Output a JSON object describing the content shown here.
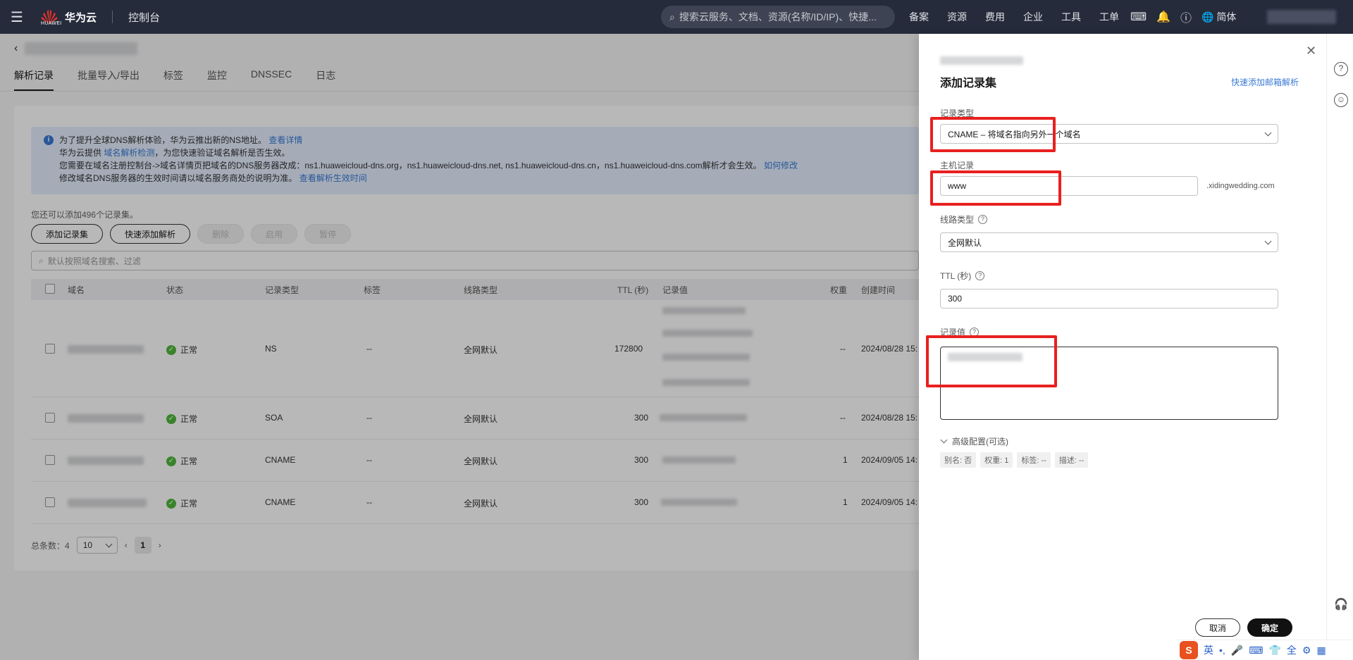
{
  "topbar": {
    "brand": "华为云",
    "brand_sub": "HUAWEI",
    "console": "控制台",
    "search_placeholder": "搜索云服务、文档、资源(名称/ID/IP)、快捷...",
    "links": [
      "备案",
      "资源",
      "费用",
      "企业",
      "工具",
      "工单"
    ],
    "lang": "简体"
  },
  "tabs": [
    "解析记录",
    "批量导入/导出",
    "标签",
    "监控",
    "DNSSEC",
    "日志"
  ],
  "notice": {
    "line1": "为了提升全球DNS解析体验，华为云推出新的NS地址。",
    "line1_link": "查看详情",
    "line2_pre": "华为云提供",
    "line2_link": "域名解析检测",
    "line2_post": "，为您快速验证域名解析是否生效。",
    "line3": "您需要在域名注册控制台->域名详情页把域名的DNS服务器改成：ns1.huaweicloud-dns.org，ns1.huaweicloud-dns.net, ns1.huaweicloud-dns.cn，ns1.huaweicloud-dns.com解析才会生效。",
    "line3_link": "如何修改",
    "line4": "修改域名DNS服务器的生效时间请以域名服务商处的说明为准。",
    "line4_link": "查看解析生效时间"
  },
  "quota": "您还可以添加496个记录集。",
  "buttons": {
    "add": "添加记录集",
    "quick": "快速添加解析",
    "delete": "删除",
    "enable": "启用",
    "pause": "暂停"
  },
  "filter_placeholder": "默认按照域名搜索、过滤",
  "table": {
    "headers": [
      "域名",
      "状态",
      "记录类型",
      "标签",
      "线路类型",
      "TTL (秒)",
      "记录值",
      "权重",
      "创建时间"
    ],
    "rows": [
      {
        "status": "正常",
        "type": "NS",
        "tag": "--",
        "line": "全网默认",
        "ttl": "172800",
        "weight": "--",
        "created": "2024/08/28 15:"
      },
      {
        "status": "正常",
        "type": "SOA",
        "tag": "--",
        "line": "全网默认",
        "ttl": "300",
        "weight": "--",
        "created": "2024/08/28 15:"
      },
      {
        "status": "正常",
        "type": "CNAME",
        "tag": "--",
        "line": "全网默认",
        "ttl": "300",
        "weight": "1",
        "created": "2024/09/05 14:"
      },
      {
        "status": "正常",
        "type": "CNAME",
        "tag": "--",
        "line": "全网默认",
        "ttl": "300",
        "weight": "1",
        "created": "2024/09/05 14:"
      }
    ]
  },
  "pager": {
    "total": "总条数：4",
    "size": "10",
    "page": "1"
  },
  "drawer": {
    "title": "添加记录集",
    "quick_link": "快速添加邮箱解析",
    "record_type_label": "记录类型",
    "record_type_value": "CNAME – 将域名指向另外一个域名",
    "host_label": "主机记录",
    "host_value": "www",
    "host_suffix": ".xidingwedding.com",
    "line_label": "线路类型",
    "line_value": "全网默认",
    "ttl_label": "TTL (秒)",
    "ttl_value": "300",
    "value_label": "记录值",
    "advanced": "高级配置(可选)",
    "adv_tags": [
      "别名: 否",
      "权重: 1",
      "标签: --",
      "描述: --"
    ],
    "cancel": "取消",
    "confirm": "确定"
  },
  "ime": {
    "logo": "S",
    "items": [
      "英",
      "•,",
      "🎤",
      "⌨",
      "👕",
      "全",
      "⚙",
      "▦"
    ]
  }
}
